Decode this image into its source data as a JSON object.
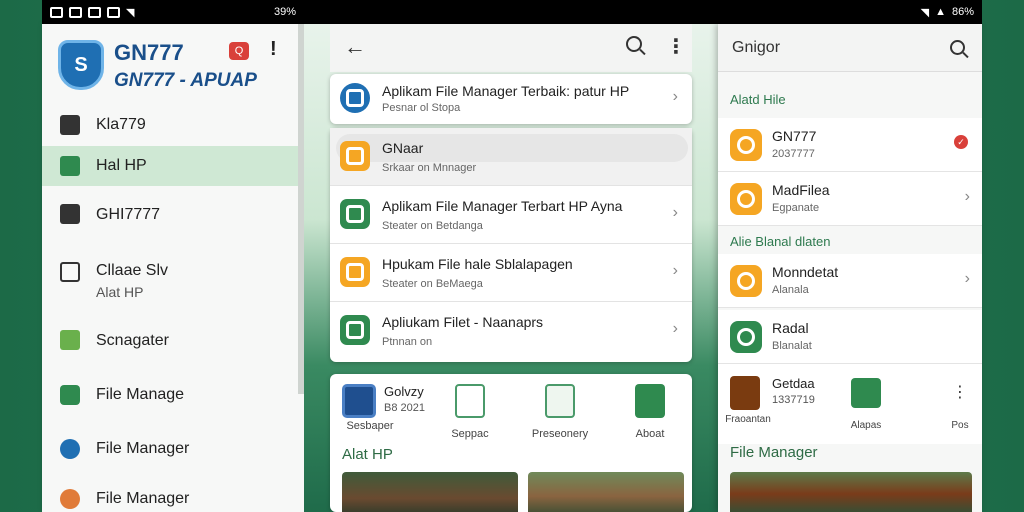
{
  "colors": {
    "background": "#1f6b4a",
    "accent_green": "#2f9a5c",
    "orange": "#f5a623",
    "blue": "#1f6fb3",
    "red_badge": "#d9403a"
  },
  "status_left": {
    "text": "39%"
  },
  "status_right": {
    "text": "86%"
  },
  "drawer": {
    "brand_title": "GN777",
    "brand_subtitle": "GN777 - APUAP",
    "badge": "Q",
    "more": "!",
    "items": [
      {
        "label": "Kla779",
        "icon": "briefcase-icon"
      },
      {
        "label": "Hal HP",
        "icon": "document-icon",
        "active": true
      },
      {
        "label": "GHI7777",
        "icon": "folder-icon"
      },
      {
        "label": "Cllaae Slv",
        "sub": "Alat HP",
        "icon": "list-icon"
      },
      {
        "label": "Scnagater",
        "icon": "sheet-icon"
      },
      {
        "label": "File Manage",
        "icon": "camera-icon"
      },
      {
        "label": "File Manager",
        "icon": "cloud-icon"
      },
      {
        "label": "File Manager",
        "icon": "gear-icon"
      }
    ]
  },
  "middle": {
    "rows": [
      {
        "title": "Aplikam File Manager Terbaik: patur HP",
        "sub": "Pesnar ol Stopa",
        "icon_color": "#1f6fb3"
      },
      {
        "title": "GNaar",
        "sub": "Srkaar on Mnnager",
        "icon_color": "#f5a623"
      },
      {
        "title": "Aplikam File Manager Terbart HP Ayna",
        "sub": "Steater on Betdanga",
        "icon_color": "#2f8a4f"
      },
      {
        "title": "Hpukam File hale Sblalapagen",
        "sub": "Steater on BeMaega",
        "icon_color": "#f5a623"
      },
      {
        "title": "Apliukam Filet - Naanaprs",
        "sub": "Ptnnan on",
        "icon_color": "#2f8a4f"
      }
    ],
    "grid_title": "Golvzy",
    "grid_sub": "B8 2021",
    "grid_tiles": [
      "Sesbaper",
      "Seppac",
      "Preseonery",
      "Aboat"
    ],
    "section_label": "Alat HP"
  },
  "right": {
    "title": "Gnigor",
    "section1": "Alatd Hile",
    "rows1": [
      {
        "title": "GN777",
        "sub": "2037777",
        "icon_color": "#f5a623",
        "badge": "✓"
      },
      {
        "title": "MadFilea",
        "sub": "Egpanate",
        "icon_color": "#f5a623"
      }
    ],
    "section2": "Alie Blanal dlaten",
    "rows2": [
      {
        "title": "Monndetat",
        "sub": "Alanala",
        "icon_color": "#f5a623"
      },
      {
        "title": "Radal",
        "sub": "Blanalat",
        "icon_color": "#2f8a4f"
      }
    ],
    "grid_title": "Getdaa",
    "grid_sub": "1337719",
    "grid_tiles": [
      "Fraoantan",
      "Alapas",
      "Pos"
    ],
    "section3": "File Manager"
  }
}
